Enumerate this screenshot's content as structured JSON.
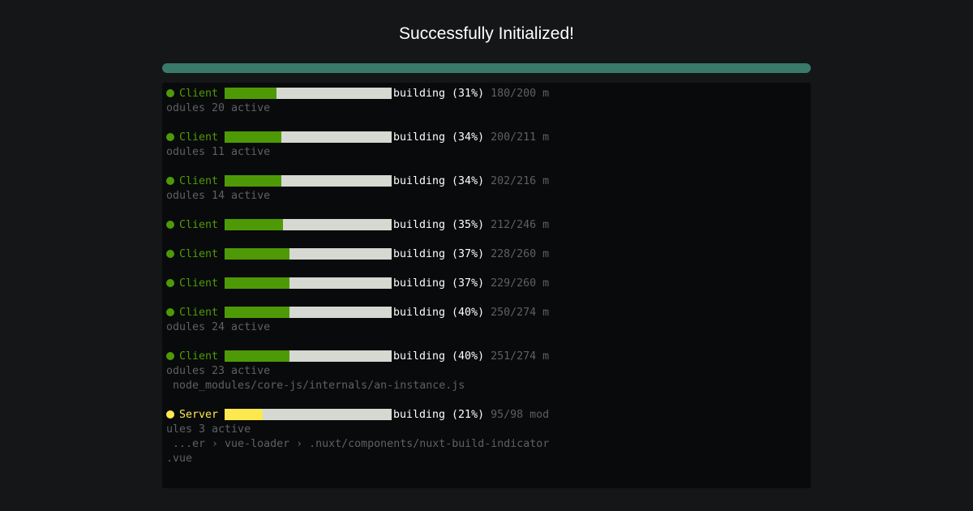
{
  "title": "Successfully Initialized!",
  "overall_progress": {
    "value": 1.0,
    "color": "#3a7a6a"
  },
  "colors": {
    "client": "#4e9a06",
    "server": "#fce94f"
  },
  "entries": [
    {
      "name": "Client",
      "kind": "client",
      "progress": 0.31,
      "status": "building (31%)",
      "counts": "180/200 m",
      "cont": "odules 20 active",
      "extra": []
    },
    {
      "name": "Client",
      "kind": "client",
      "progress": 0.34,
      "status": "building (34%)",
      "counts": "200/211 m",
      "cont": "odules 11 active",
      "extra": []
    },
    {
      "name": "Client",
      "kind": "client",
      "progress": 0.34,
      "status": "building (34%)",
      "counts": "202/216 m",
      "cont": "odules 14 active",
      "extra": []
    },
    {
      "name": "Client",
      "kind": "client",
      "progress": 0.35,
      "status": "building (35%)",
      "counts": "212/246 m",
      "cont": "",
      "extra": []
    },
    {
      "name": "Client",
      "kind": "client",
      "progress": 0.39,
      "status": "building (37%)",
      "counts": "228/260 m",
      "cont": "",
      "extra": []
    },
    {
      "name": "Client",
      "kind": "client",
      "progress": 0.39,
      "status": "building (37%)",
      "counts": "229/260 m",
      "cont": "",
      "extra": []
    },
    {
      "name": "Client",
      "kind": "client",
      "progress": 0.39,
      "status": "building (40%)",
      "counts": "250/274 m",
      "cont": "odules 24 active",
      "extra": []
    },
    {
      "name": "Client",
      "kind": "client",
      "progress": 0.39,
      "status": "building (40%)",
      "counts": "251/274 m",
      "cont": "odules 23 active",
      "extra": [
        " node_modules/core-js/internals/an-instance.js"
      ]
    },
    {
      "name": "Server",
      "kind": "server",
      "progress": 0.23,
      "status": "building (21%)",
      "counts": "95/98 mod",
      "cont": "ules 3 active",
      "extra": [
        " ...er › vue-loader › .nuxt/components/nuxt-build-indicator",
        ".vue"
      ]
    }
  ]
}
